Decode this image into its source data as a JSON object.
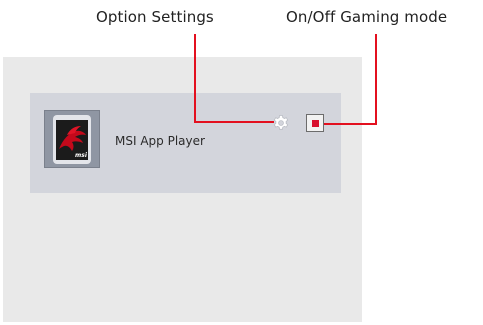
{
  "callouts": {
    "option_settings": "Option Settings",
    "gaming_mode": "On/Off Gaming mode"
  },
  "app": {
    "name": "MSI App Player",
    "thumbnail_icon": "msi-dragon-logo-icon",
    "thumbnail_brand_text": "msi",
    "settings_icon": "gear-icon",
    "gaming_mode_toggle": {
      "checked": true
    }
  },
  "colors": {
    "panel_bg": "#e9e9e9",
    "card_bg": "#d3d5dc",
    "leader_line": "#e3101f",
    "toggle_fill": "#d8102e",
    "thumb_red": "#c4091b"
  }
}
